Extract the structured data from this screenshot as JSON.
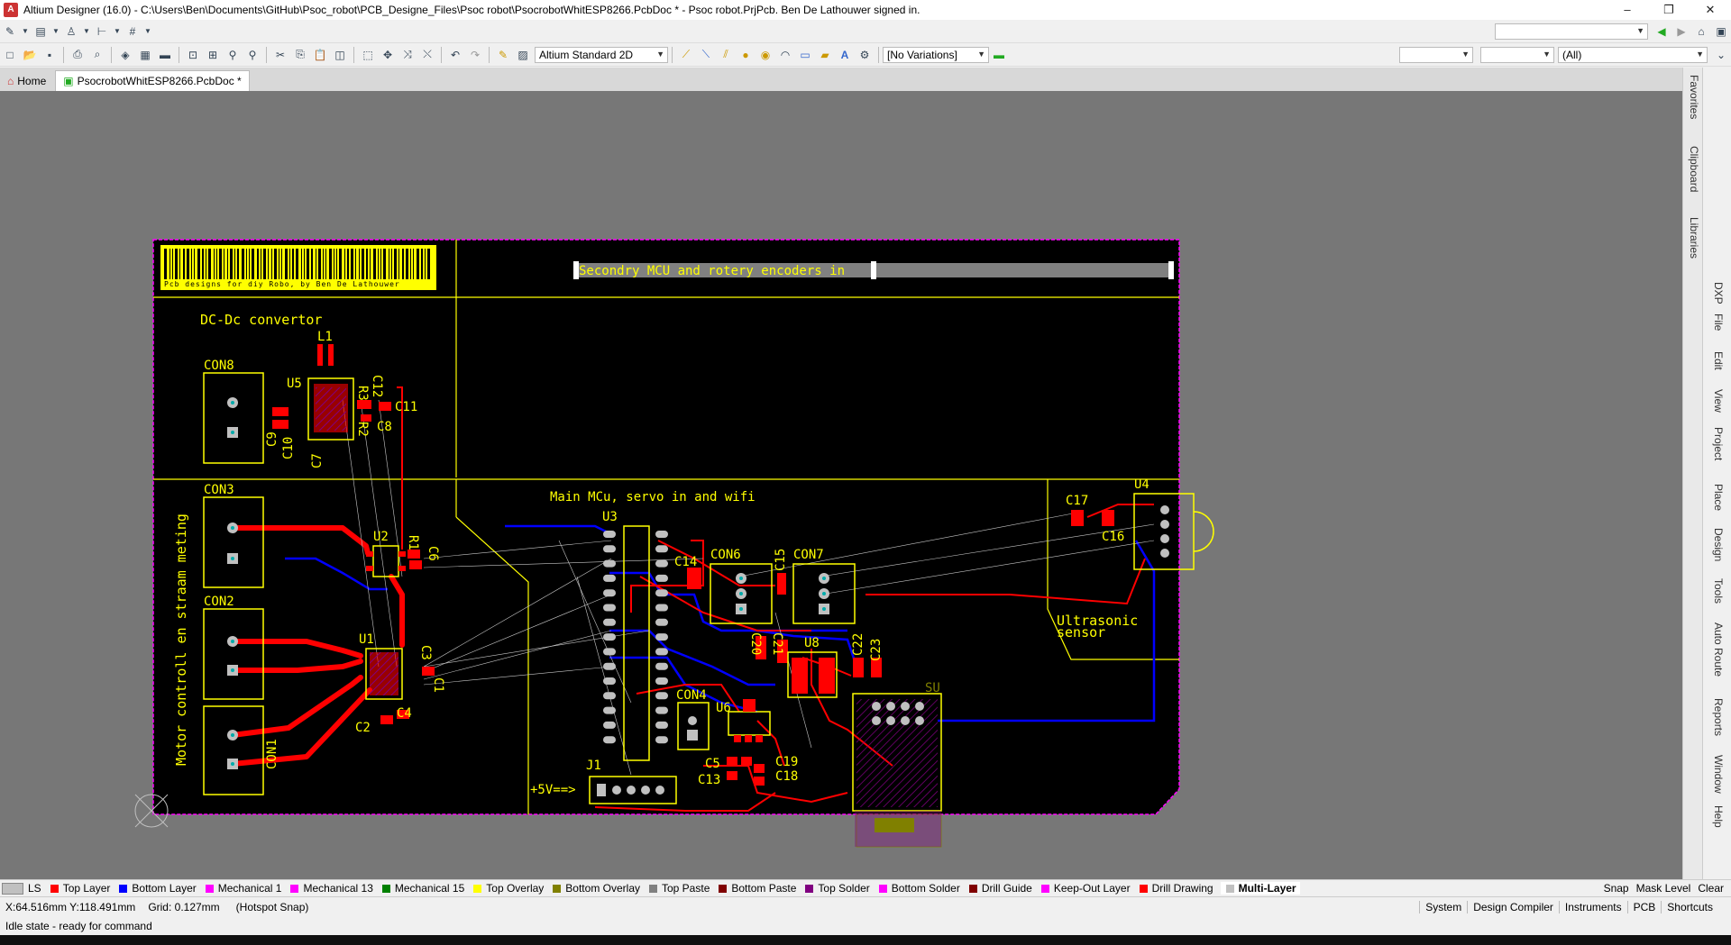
{
  "window": {
    "title": "Altium Designer (16.0) - C:\\Users\\Ben\\Documents\\GitHub\\Psoc_robot\\PCB_Designe_Files\\Psoc robot\\PsocrobotWhitESP8266.PcbDoc * - Psoc robot.PrjPcb. Ben De Lathouwer signed in.",
    "minimize": "–",
    "maximize": "❐",
    "close": "✕"
  },
  "toolbar": {
    "view_mode": "Altium Standard 2D",
    "variations": "[No Variations]",
    "filter_all": "(All)"
  },
  "tabs": {
    "home": "Home",
    "document": "PsocrobotWhitESP8266.PcbDoc *"
  },
  "side_panels": [
    "Favorites",
    "Clipboard",
    "Libraries"
  ],
  "menu_panels": [
    "DXP",
    "File",
    "Edit",
    "View",
    "Project",
    "Place",
    "Design",
    "Tools",
    "Auto Route",
    "Reports",
    "Window",
    "Help"
  ],
  "pcb": {
    "barcode_text": "Pcb designs  for diy Robo, by Ben De Lathouwer",
    "section_dcdc": "DC-Dc convertor",
    "section_secondary": "Secondry MCU and rotery encoders in",
    "section_main": "Main MCu, servo in and  wifi",
    "section_motor": "Motor controll en straam meting",
    "section_ultrasonic_1": "Ultrasonic",
    "section_ultrasonic_2": "sensor",
    "power_label": "+5V==>",
    "designators": {
      "con8": "CON8",
      "l1": "L1",
      "u5": "U5",
      "r3": "R3",
      "c12": "C12",
      "c11": "C11",
      "c8": "C8",
      "r2": "R2",
      "c9": "C9",
      "c10": "C10",
      "c7": "C7",
      "con3": "CON3",
      "u2": "U2",
      "r1": "R1",
      "c6": "C6",
      "con2": "CON2",
      "u1": "U1",
      "c3": "C3",
      "c1": "C1",
      "c2": "C2",
      "c4": "C4",
      "con1": "CON1",
      "u3": "U3",
      "c14": "C14",
      "con6": "CON6",
      "c15": "C15",
      "con7": "CON7",
      "c17": "C17",
      "u4": "U4",
      "c16": "C16",
      "c20": "C20",
      "c21": "C21",
      "u8": "U8",
      "c22": "C22",
      "c23": "C23",
      "su": "SU",
      "con4": "CON4",
      "u6": "U6",
      "c5": "C5",
      "c13": "C13",
      "c19": "C19",
      "c18": "C18",
      "j1": "J1"
    }
  },
  "layers": [
    {
      "name": "LS",
      "color": "#c0c0c0"
    },
    {
      "name": "Top Layer",
      "color": "#ff0000"
    },
    {
      "name": "Bottom Layer",
      "color": "#0000ff"
    },
    {
      "name": "Mechanical 1",
      "color": "#ff00ff"
    },
    {
      "name": "Mechanical 13",
      "color": "#ff00ff"
    },
    {
      "name": "Mechanical 15",
      "color": "#008000"
    },
    {
      "name": "Top Overlay",
      "color": "#ffff00"
    },
    {
      "name": "Bottom Overlay",
      "color": "#808000"
    },
    {
      "name": "Top Paste",
      "color": "#808080"
    },
    {
      "name": "Bottom Paste",
      "color": "#800000"
    },
    {
      "name": "Top Solder",
      "color": "#800080"
    },
    {
      "name": "Bottom Solder",
      "color": "#ff00ff"
    },
    {
      "name": "Drill Guide",
      "color": "#800000"
    },
    {
      "name": "Keep-Out Layer",
      "color": "#ff00ff"
    },
    {
      "name": "Drill Drawing",
      "color": "#ff0000"
    },
    {
      "name": "Multi-Layer",
      "color": "#c0c0c0"
    }
  ],
  "layer_controls": [
    "Snap",
    "Mask Level",
    "Clear"
  ],
  "status": {
    "coords": "X:64.516mm Y:118.491mm",
    "grid": "Grid: 0.127mm",
    "snap": "(Hotspot Snap)",
    "state": "Idle state - ready for command"
  },
  "status_panels": [
    "System",
    "Design Compiler",
    "Instruments",
    "PCB",
    "Shortcuts"
  ]
}
